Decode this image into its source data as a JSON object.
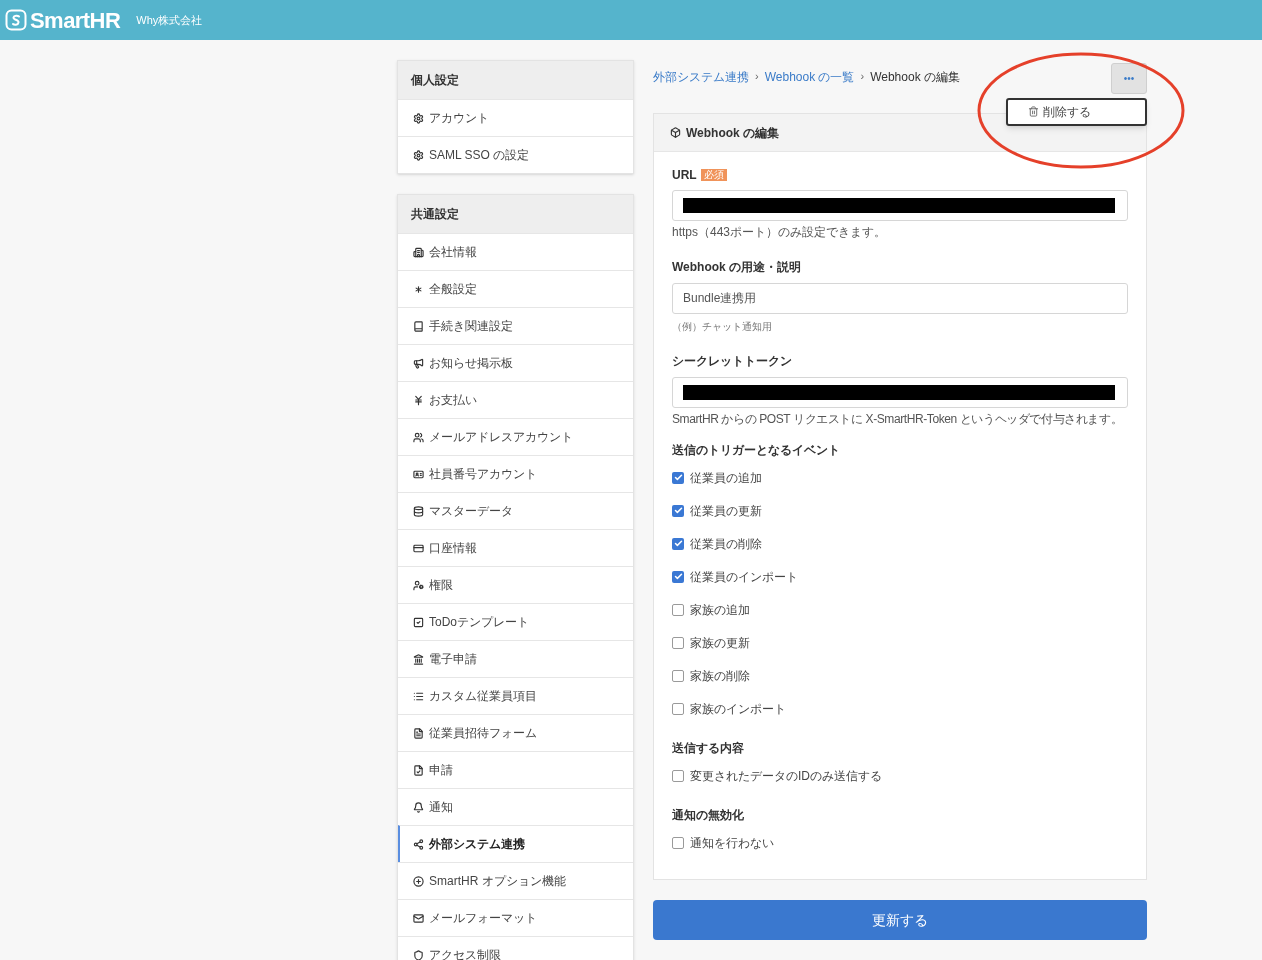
{
  "header": {
    "logo": "SmartHR",
    "company": "Why株式会社"
  },
  "sidebar": {
    "sections": [
      {
        "title": "個人設定",
        "items": [
          {
            "label": "アカウント",
            "selected": false
          },
          {
            "label": "SAML SSO の設定",
            "selected": false
          }
        ]
      },
      {
        "title": "共通設定",
        "items": [
          {
            "label": "会社情報",
            "selected": false
          },
          {
            "label": "全般設定",
            "selected": false
          },
          {
            "label": "手続き関連設定",
            "selected": false
          },
          {
            "label": "お知らせ掲示板",
            "selected": false
          },
          {
            "label": "お支払い",
            "selected": false
          },
          {
            "label": "メールアドレスアカウント",
            "selected": false
          },
          {
            "label": "社員番号アカウント",
            "selected": false
          },
          {
            "label": "マスターデータ",
            "selected": false
          },
          {
            "label": "口座情報",
            "selected": false
          },
          {
            "label": "権限",
            "selected": false
          },
          {
            "label": "ToDoテンプレート",
            "selected": false
          },
          {
            "label": "電子申請",
            "selected": false
          },
          {
            "label": "カスタム従業員項目",
            "selected": false
          },
          {
            "label": "従業員招待フォーム",
            "selected": false
          },
          {
            "label": "申請",
            "selected": false
          },
          {
            "label": "通知",
            "selected": false
          },
          {
            "label": "外部システム連携",
            "selected": true
          },
          {
            "label": "SmartHR オプション機能",
            "selected": false
          },
          {
            "label": "メールフォーマット",
            "selected": false
          },
          {
            "label": "アクセス制限",
            "selected": false
          }
        ]
      }
    ]
  },
  "breadcrumb_separator": "›",
  "breadcrumbs": [
    {
      "label": "外部システム連携",
      "link": true
    },
    {
      "label": "Webhook の一覧",
      "link": true
    },
    {
      "label": "Webhook の編集",
      "link": false
    }
  ],
  "more_menu": {
    "button": "•••",
    "items": [
      "削除する"
    ]
  },
  "card": {
    "title": "Webhook の編集",
    "url": {
      "label": "URL",
      "badge": "必須",
      "hint": "https（443ポート）のみ設定できます。"
    },
    "description": {
      "label": "Webhook の用途・説明",
      "value": "Bundle連携用",
      "hint": "（例）チャット通知用"
    },
    "secret": {
      "label": "シークレットトークン",
      "hint": "SmartHR からの POST リクエストに X-SmartHR-Token というヘッダで付与されます。"
    },
    "groups": [
      {
        "title": "送信のトリガーとなるイベント",
        "options": [
          {
            "label": "従業員の追加",
            "checked": true
          },
          {
            "label": "従業員の更新",
            "checked": true
          },
          {
            "label": "従業員の削除",
            "checked": true
          },
          {
            "label": "従業員のインポート",
            "checked": true
          },
          {
            "label": "家族の追加",
            "checked": false
          },
          {
            "label": "家族の更新",
            "checked": false
          },
          {
            "label": "家族の削除",
            "checked": false
          },
          {
            "label": "家族のインポート",
            "checked": false
          }
        ]
      },
      {
        "title": "送信する内容",
        "options": [
          {
            "label": "変更されたデータのIDのみ送信する",
            "checked": false
          }
        ]
      },
      {
        "title": "通知の無効化",
        "options": [
          {
            "label": "通知を行わない",
            "checked": false
          }
        ]
      }
    ]
  },
  "submit": "更新する"
}
